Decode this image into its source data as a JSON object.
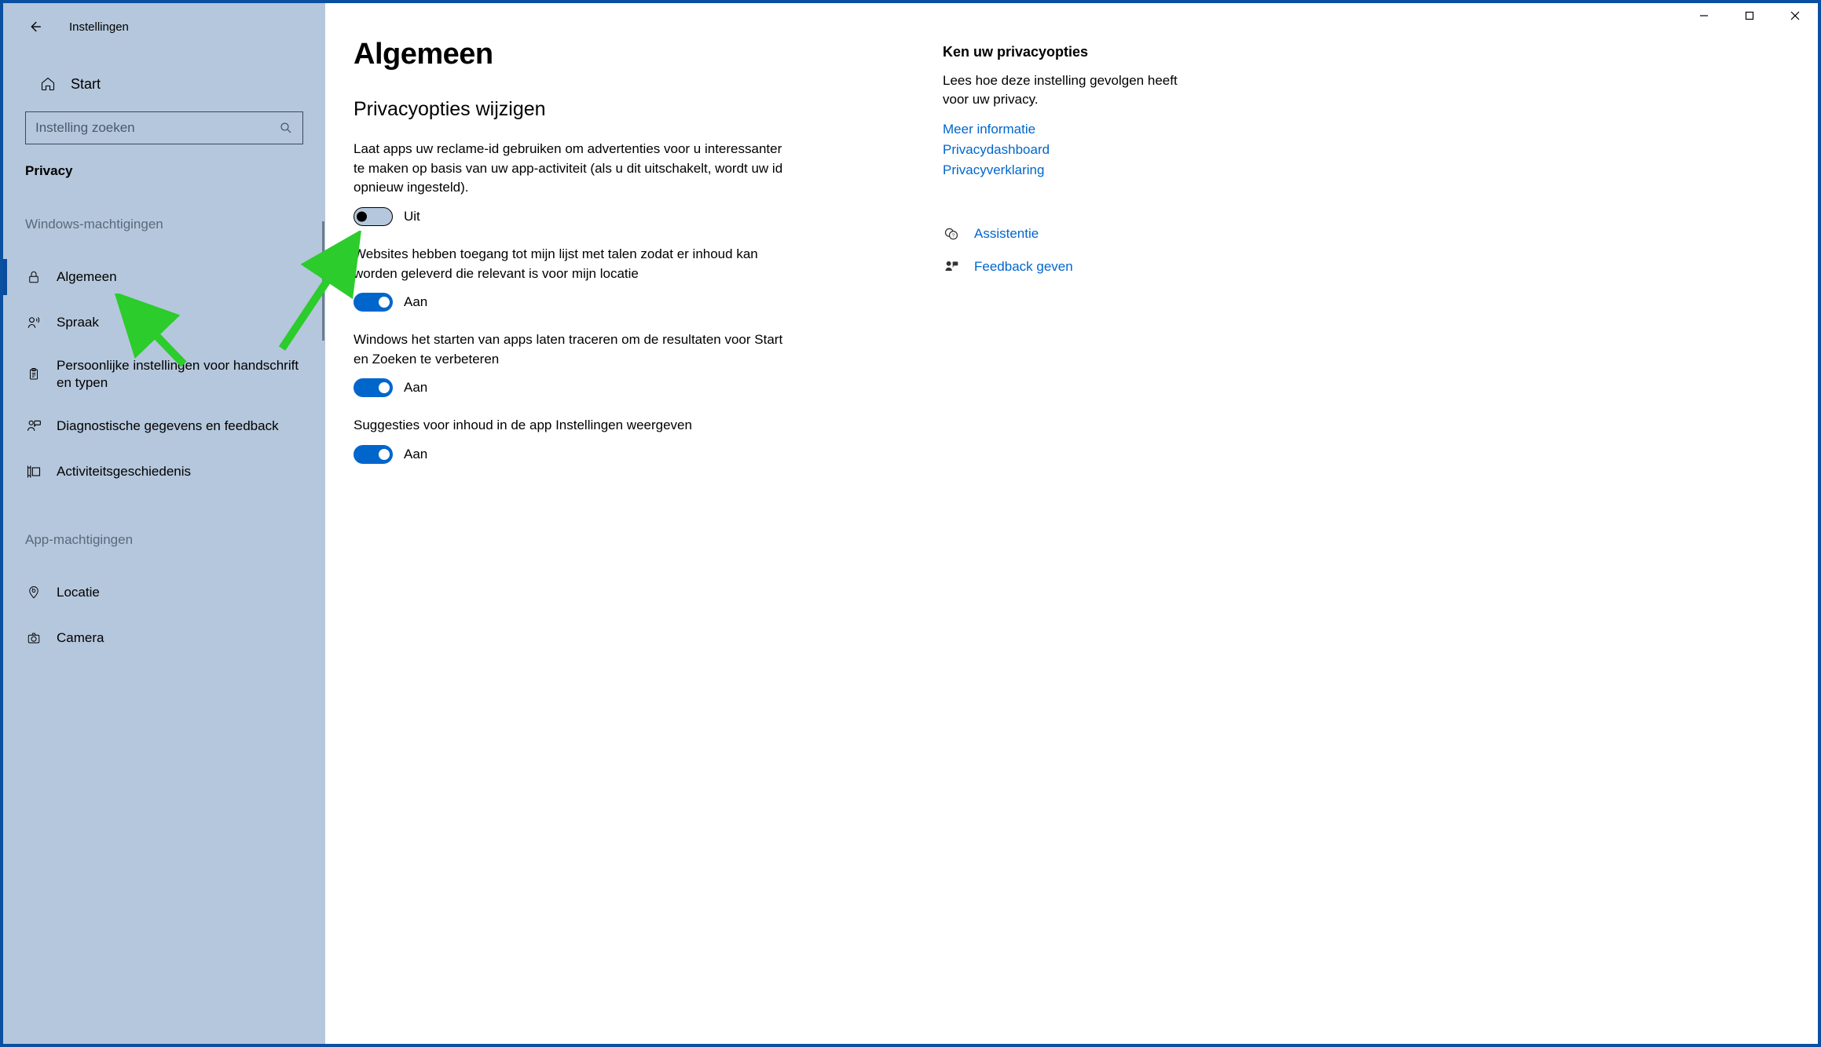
{
  "window": {
    "app_title": "Instellingen"
  },
  "sidebar": {
    "home_label": "Start",
    "search_placeholder": "Instelling zoeken",
    "privacy_label": "Privacy",
    "section_windows": "Windows-machtigingen",
    "section_apps": "App-machtigingen",
    "items_windows": [
      {
        "label": "Algemeen",
        "icon": "lock",
        "active": true
      },
      {
        "label": "Spraak",
        "icon": "voice",
        "active": false
      },
      {
        "label": "Persoonlijke instellingen voor handschrift en typen",
        "icon": "clipboard",
        "active": false,
        "multiline": true
      },
      {
        "label": "Diagnostische gegevens en feedback",
        "icon": "feedback",
        "active": false
      },
      {
        "label": "Activiteitsgeschiedenis",
        "icon": "history",
        "active": false
      }
    ],
    "items_apps": [
      {
        "label": "Locatie",
        "icon": "location",
        "active": false
      },
      {
        "label": "Camera",
        "icon": "camera",
        "active": false
      }
    ]
  },
  "main": {
    "title": "Algemeen",
    "section_title": "Privacyopties wijzigen",
    "settings": [
      {
        "desc": "Laat apps uw reclame-id gebruiken om advertenties voor u interessanter te maken op basis van uw app-activiteit (als u dit uitschakelt, wordt uw id opnieuw ingesteld).",
        "on": false,
        "state_label": "Uit"
      },
      {
        "desc": "Websites hebben toegang tot mijn lijst met talen zodat er inhoud kan worden geleverd die relevant is voor mijn locatie",
        "on": true,
        "state_label": "Aan"
      },
      {
        "desc": "Windows het starten van apps laten traceren om de resultaten voor Start en Zoeken te verbeteren",
        "on": true,
        "state_label": "Aan"
      },
      {
        "desc": "Suggesties voor inhoud in de app Instellingen weergeven",
        "on": true,
        "state_label": "Aan"
      }
    ]
  },
  "aside": {
    "title": "Ken uw privacyopties",
    "desc": "Lees hoe deze instelling gevolgen heeft voor uw privacy.",
    "links": [
      "Meer informatie",
      "Privacydashboard",
      "Privacyverklaring"
    ],
    "help_link": "Assistentie",
    "feedback_link": "Feedback geven"
  }
}
